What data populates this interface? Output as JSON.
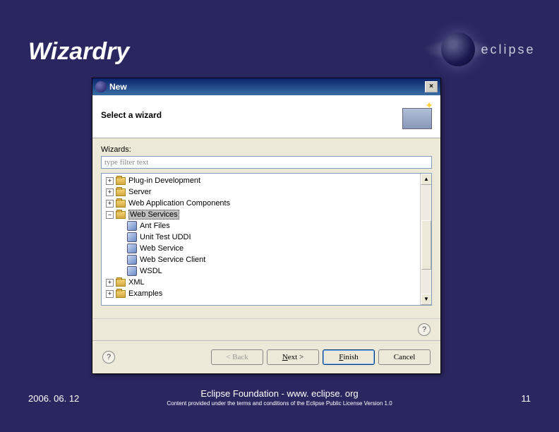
{
  "slide": {
    "title": "Wizardry",
    "logo_text": "eclipse"
  },
  "footer": {
    "date": "2006. 06. 12",
    "main": "Eclipse Foundation - www. eclipse. org",
    "sub": "Content provided under the terms and conditions of the Eclipse Public License Version 1.0",
    "page": "11"
  },
  "dialog": {
    "title": "New",
    "close": "×",
    "banner_title": "Select a wizard",
    "wizards_label": "Wizards:",
    "filter_placeholder": "type filter text",
    "tree": {
      "plugin_dev": "Plug-in Development",
      "server": "Server",
      "web_app": "Web Application Components",
      "web_services": "Web Services",
      "ant_files": "Ant Files",
      "unit_test": "Unit Test UDDI",
      "web_service": "Web Service",
      "web_service_client": "Web Service Client",
      "wsdl": "WSDL",
      "xml": "XML",
      "examples": "Examples"
    },
    "expander_plus": "+",
    "expander_minus": "−",
    "help": "?",
    "buttons": {
      "back": "< Back",
      "next": "Next >",
      "finish": "Finish",
      "cancel": "Cancel"
    },
    "scroll_up": "▲",
    "scroll_down": "▼"
  }
}
